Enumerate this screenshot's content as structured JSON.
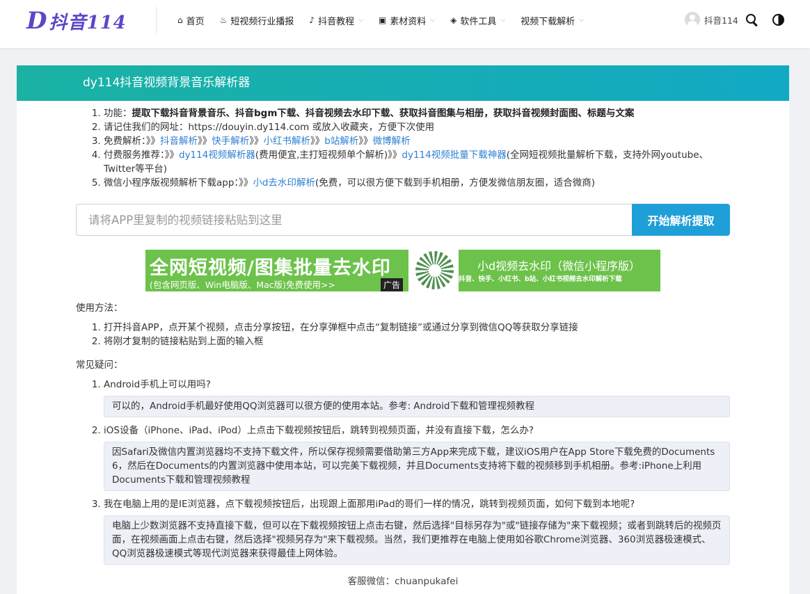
{
  "header": {
    "logo_text": "抖音114",
    "logo_letter": "D",
    "nav": [
      {
        "icon": "home-icon",
        "glyph": "⌂",
        "label": "首页",
        "dropdown": false
      },
      {
        "icon": "fire-icon",
        "glyph": "🔥",
        "label": "短视频行业播报",
        "dropdown": false
      },
      {
        "icon": "tiktok-icon",
        "glyph": "♪",
        "label": "抖音教程",
        "dropdown": true
      },
      {
        "icon": "image-icon",
        "glyph": "▣",
        "label": "素材资料",
        "dropdown": true
      },
      {
        "icon": "cube-icon",
        "glyph": "◈",
        "label": "软件工具",
        "dropdown": true
      },
      {
        "icon": "",
        "glyph": "",
        "label": "视频下载解析",
        "dropdown": true
      }
    ],
    "user_name": "抖音114"
  },
  "card": {
    "title": "dy114抖音视频背景音乐解析器"
  },
  "features": [
    {
      "prefix": "功能：",
      "bold": "提取下载抖音背景音乐、抖音bgm下载、抖音视频去水印下载、获取抖音图集与相册，获取抖音视频封面图、标题与文案"
    },
    {
      "text": "请记住我们的网址：https://douyin.dy114.com 或放入收藏夹，方便下次使用"
    },
    {
      "prefix": "免费解析：》》",
      "link1": "抖音解析",
      "sep1": "》》",
      "link2": "快手解析",
      "sep2": "》》",
      "link3": "小红书解析",
      "sep3": "》》",
      "link4": "b站解析",
      "sep4": "》》",
      "link5": "微博解析"
    },
    {
      "prefix": "付费服务推荐：》》",
      "link1": "dy114视频解析器",
      "mid": "(费用便宜,主打短视频单个解析)》》",
      "link2": "dy114视频批量下载神器",
      "suffix": "(全网短视频批量解析下载，支持外网youtube、Twitter等平台)"
    },
    {
      "prefix": "微信小程序版视频解析下载app：》》",
      "link1": "小d去水印解析",
      "suffix": "(免费，可以很方便下载到手机相册，方便发微信朋友圈，适合微商)"
    }
  ],
  "search": {
    "placeholder": "请将APP里复制的视频链接粘贴到这里",
    "button": "开始解析提取"
  },
  "banner": {
    "left_big": "全网短视频/图集批量去水印",
    "left_small": "(包含网页版、Win电脑版、Mac版)免费使用>>",
    "ad_tag": "广告",
    "right_title": "小d视频去水印（微信小程序版）",
    "right_sub": "抖音、快手、小红书、b站、小红书视频去水印解析下载"
  },
  "usage": {
    "label": "使用方法：",
    "steps": [
      "打开抖音APP，点开某个视频，点击分享按钮，在分享弹框中点击“复制链接”或通过分享到微信QQ等获取分享链接",
      "将刚才复制的链接粘贴到上面的输入框"
    ]
  },
  "faq": {
    "label": "常见疑问：",
    "items": [
      {
        "q": "Android手机上可以用吗?",
        "a": "可以的，Android手机最好使用QQ浏览器可以很方便的使用本站。参考: Android下载和管理视频教程"
      },
      {
        "q": "iOS设备（iPhone、iPad、iPod）上点击下载视频按钮后，跳转到视频页面，并没有直接下载，怎么办?",
        "a": "因Safari及微信内置浏览器均不支持下载文件，所以保存视频需要借助第三方App来完成下载，建议iOS用户在App Store下载免费的Documents 6，然后在Documents的内置浏览器中使用本站，可以完美下载视频，并且Documents支持将下载的视频移到手机相册。参考:iPhone上利用Documents下载和管理视频教程"
      },
      {
        "q": "我在电脑上用的是IE浏览器，点下载视频按钮后，出现跟上面那用iPad的哥们一样的情况，跳转到视频页面，如何下载到本地呢?",
        "a": "电脑上少数浏览器不支持直接下载，但可以在下载视频按钮上点击右键，然后选择\"目标另存为\"或\"链接存储为\"来下载视频；或者到跳转后的视频页面，在视频画面上点击右键，然后选择\"视频另存为\"来下载视频。当然，我们更推荐在电脑上使用如谷歌Chrome浏览器、360浏览器极速模式、QQ浏览器极速模式等现代浏览器来获得最佳上网体验。"
      }
    ]
  },
  "contact": "客服微信：chuanpukafei"
}
